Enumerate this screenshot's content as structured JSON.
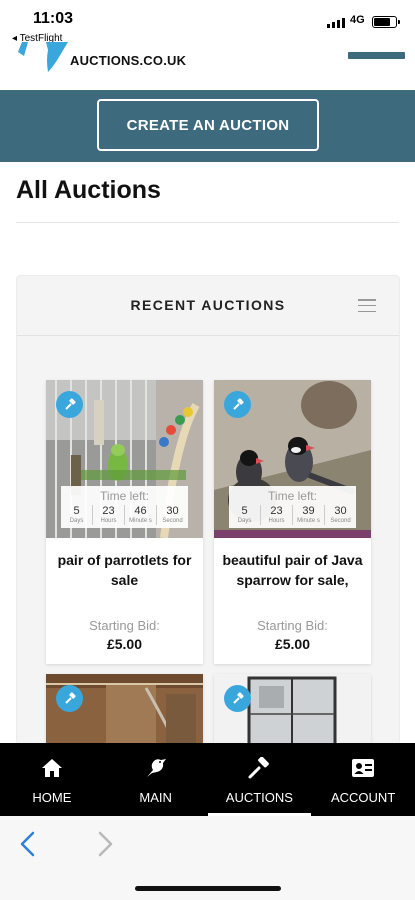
{
  "status_bar": {
    "time": "11:03",
    "back_app": "◂ TestFlight",
    "network": "4G"
  },
  "header": {
    "logo_text": "AUCTIONS.CO.UK",
    "create_label": "CREATE AN AUCTION"
  },
  "page": {
    "title": "All Auctions"
  },
  "panel": {
    "title": "RECENT AUCTIONS",
    "cards": [
      {
        "title": "pair of parrotlets for sale",
        "time_left_label": "Time left:",
        "timer": [
          {
            "value": "5",
            "unit": "Days"
          },
          {
            "value": "23",
            "unit": "Hours"
          },
          {
            "value": "46",
            "unit": "Minute s"
          },
          {
            "value": "30",
            "unit": "Second"
          }
        ],
        "bid_label": "Starting Bid:",
        "bid_value": "£5.00"
      },
      {
        "title": "beautiful pair of Java sparrow for sale,",
        "time_left_label": "Time left:",
        "timer": [
          {
            "value": "5",
            "unit": "Days"
          },
          {
            "value": "23",
            "unit": "Hours"
          },
          {
            "value": "39",
            "unit": "Minute s"
          },
          {
            "value": "30",
            "unit": "Second"
          }
        ],
        "bid_label": "Starting Bid:",
        "bid_value": "£5.00"
      }
    ]
  },
  "tabs": [
    {
      "label": "HOME",
      "icon": "home-icon"
    },
    {
      "label": "MAIN",
      "icon": "bird-icon"
    },
    {
      "label": "AUCTIONS",
      "icon": "gavel-icon",
      "active": true
    },
    {
      "label": "ACCOUNT",
      "icon": "id-card-icon"
    }
  ],
  "colors": {
    "brand_teal": "#3e6a7d",
    "pin_blue": "#3aa7dc",
    "tabbar_bg": "#000000",
    "nav_blue": "#2f7fd8"
  }
}
